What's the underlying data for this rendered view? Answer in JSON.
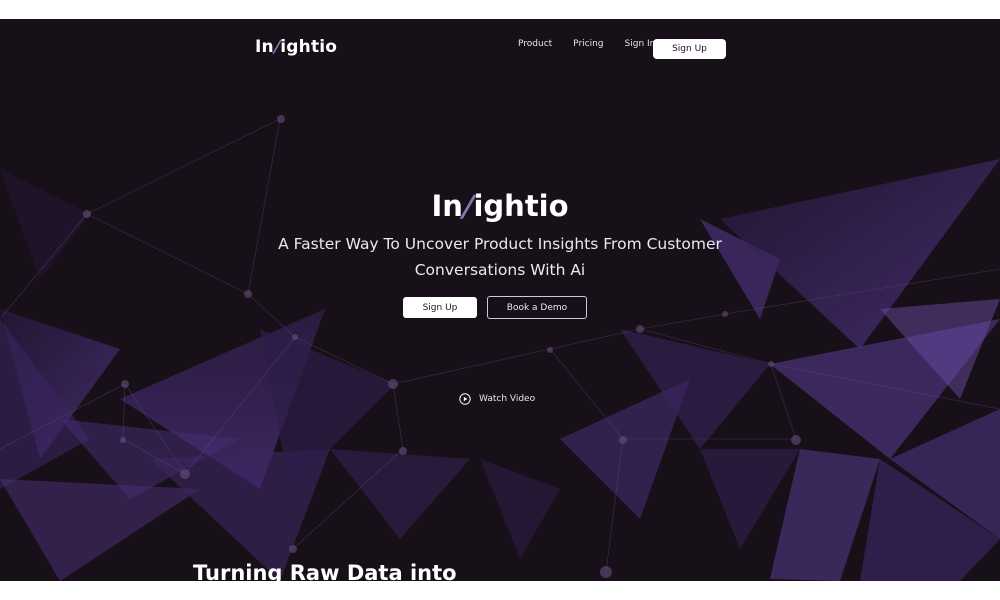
{
  "brand": {
    "name_prefix": "In",
    "name_slash": "/",
    "name_suffix": "ightio"
  },
  "nav": {
    "links": [
      "Product",
      "Pricing",
      "Sign In"
    ],
    "signup_label": "Sign Up"
  },
  "hero": {
    "title_prefix": "In",
    "title_slash": "/",
    "title_suffix": "ightio",
    "subtitle": "A Faster Way To Uncover Product Insights From Customer Conversations With Ai",
    "primary_button": "Sign Up",
    "secondary_button": "Book a Demo",
    "watch_video": "Watch Video"
  },
  "section": {
    "heading": "Turning Raw Data into"
  },
  "colors": {
    "background": "#181019",
    "accent_purple": "#5a3b8a",
    "text": "#ffffff"
  }
}
